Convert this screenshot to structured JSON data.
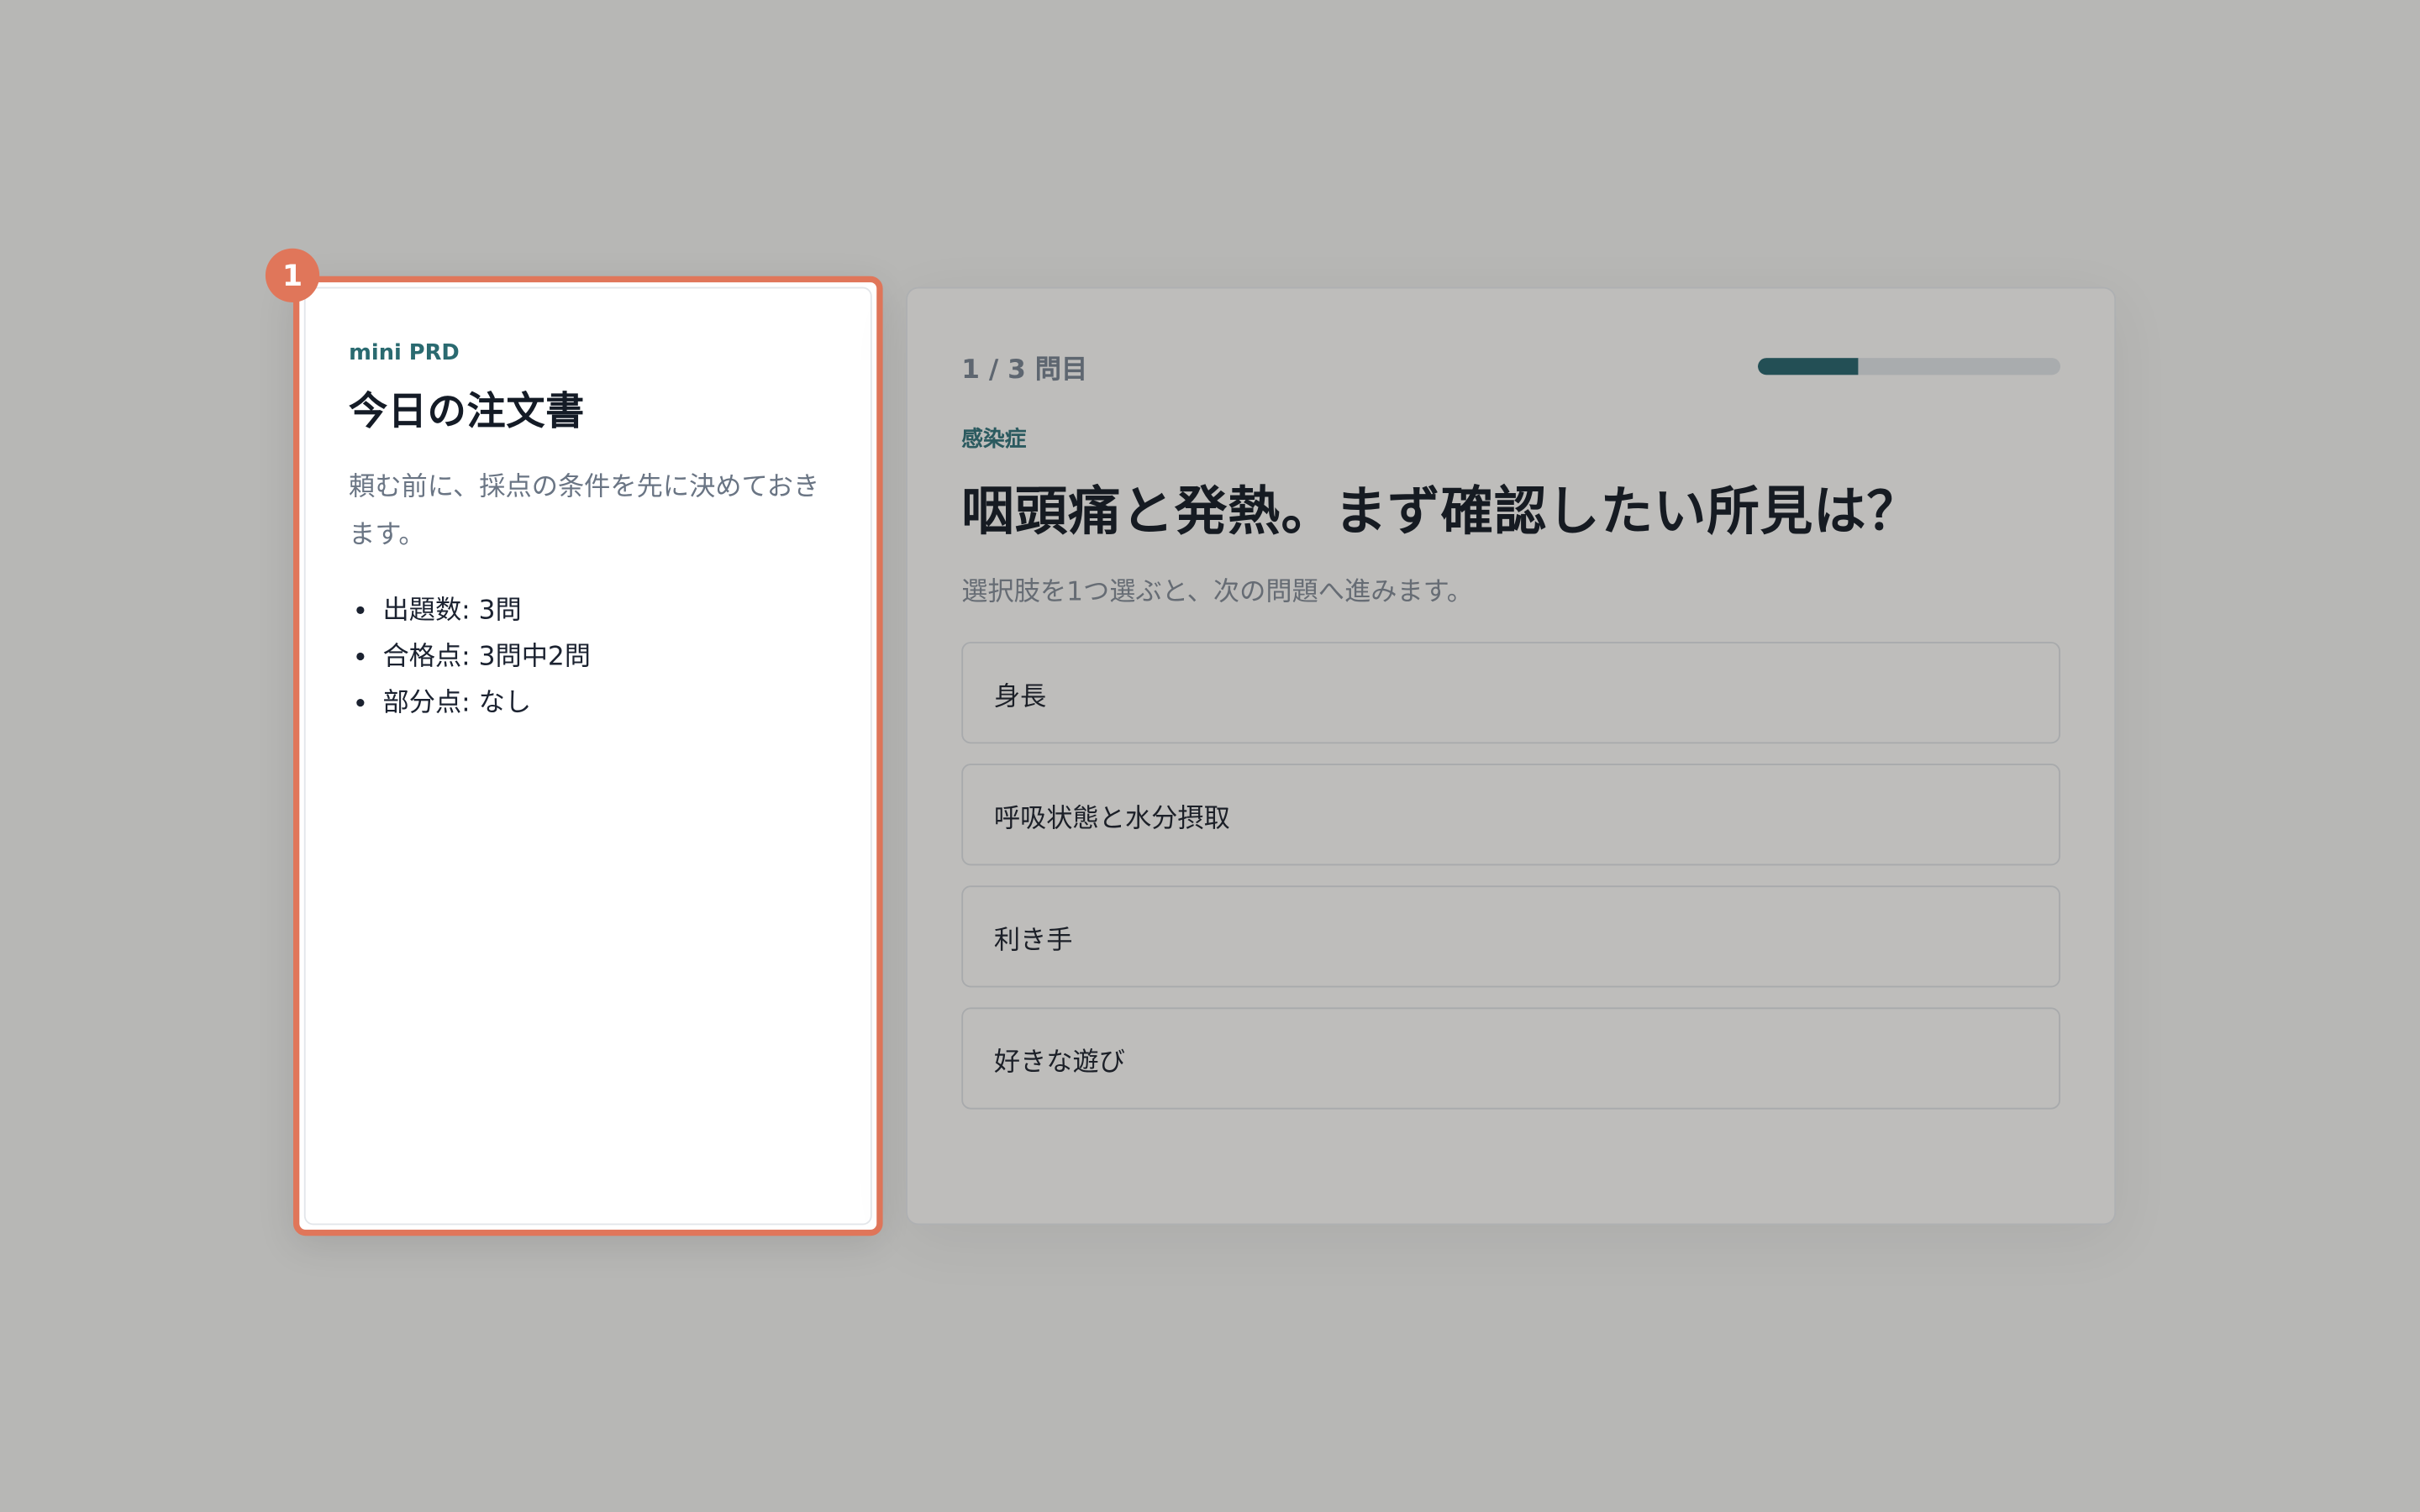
{
  "prd": {
    "badge": "1",
    "kicker": "mini PRD",
    "title": "今日の注文書",
    "description": "頼む前に、採点の条件を先に決めておきます。",
    "items": [
      "出題数: 3問",
      "合格点: 3問中2問",
      "部分点: なし"
    ]
  },
  "quiz": {
    "step_label": "1 / 3 問目",
    "progress": {
      "current": 1,
      "total": 3
    },
    "category": "感染症",
    "question": "咽頭痛と発熱。まず確認したい所見は？",
    "instruction": "選択肢を1つ選ぶと、次の問題へ進みます。",
    "options": [
      "身長",
      "呼吸状態と水分摂取",
      "利き手",
      "好きな遊び"
    ]
  },
  "colors": {
    "highlight": "#e0765a",
    "accent": "#2a6a70",
    "progress_fill": "#234f55",
    "overlay_bg": "#b7b7b5"
  }
}
